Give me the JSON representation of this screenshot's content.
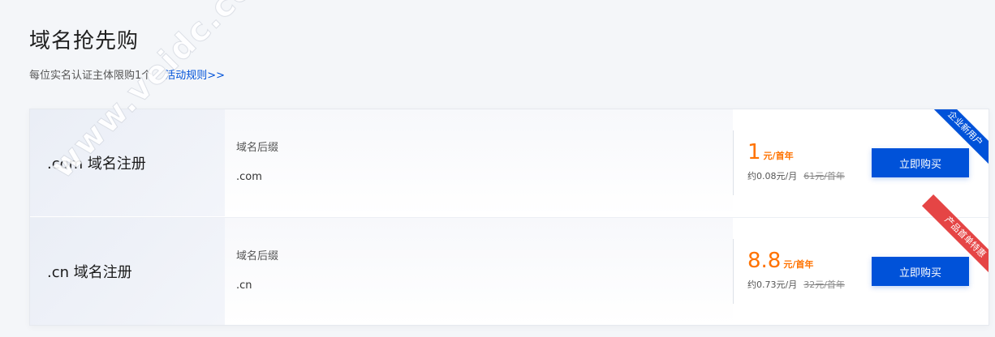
{
  "page": {
    "title": "域名抢先购",
    "subtitle": "每位实名认证主体限购1个",
    "rules_link": "活动规则>>"
  },
  "products": [
    {
      "name": ".com 域名注册",
      "suffix_label": "域名后缀",
      "suffix_value": ".com",
      "price": "1",
      "price_unit": "元/首年",
      "monthly": "约0.08元/月",
      "original_price": "61元/首年",
      "button": "立即购买",
      "ribbon": "企业新用户",
      "ribbon_color": "#0052d9"
    },
    {
      "name": ".cn 域名注册",
      "suffix_label": "域名后缀",
      "suffix_value": ".cn",
      "price": "8.8",
      "price_unit": "元/首年",
      "monthly": "约0.73元/月",
      "original_price": "32元/首年",
      "button": "立即购买",
      "ribbon": "产品首单特惠",
      "ribbon_color": "#e54545"
    }
  ],
  "watermark": "www.veidc.com",
  "colors": {
    "accent": "#0052d9",
    "price": "#ff7200",
    "background": "#f4f6f9"
  }
}
